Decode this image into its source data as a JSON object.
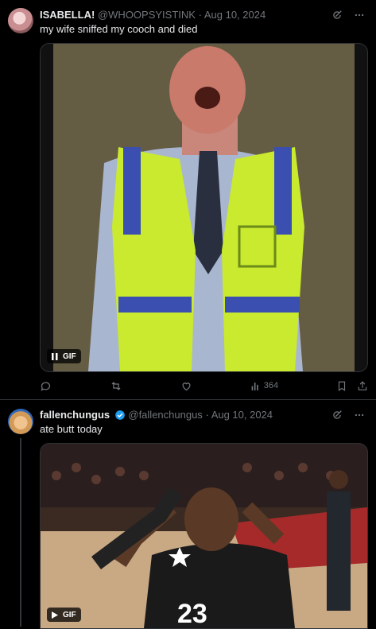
{
  "tweets": [
    {
      "name": "ISABELLA!",
      "handle": "@WHOOPSYISTINK",
      "separator": "·",
      "date": "Aug 10, 2024",
      "text": "my wife sniffed my cooch and died",
      "media_badge": "GIF",
      "views": "364"
    },
    {
      "name": "fallenchungus",
      "handle": "@fallenchungus",
      "separator": "·",
      "date": "Aug 10, 2024",
      "text": "ate butt today",
      "media_badge": "GIF",
      "jersey_number": "23"
    }
  ],
  "icons": {
    "grok": "grok-icon",
    "more": "more-icon",
    "reply": "reply-icon",
    "retweet": "retweet-icon",
    "like": "like-icon",
    "views": "views-icon",
    "bookmark": "bookmark-icon",
    "share": "share-icon",
    "verified": "verified-badge-icon",
    "pause": "pause-icon",
    "play": "play-icon"
  },
  "colors": {
    "background": "#000000",
    "text": "#e7e9ea",
    "muted": "#71767b",
    "verified": "#1d9bf0",
    "border": "#2f3336",
    "vest": "#c9ea2e",
    "vest_stripe": "#3b4fb0"
  }
}
